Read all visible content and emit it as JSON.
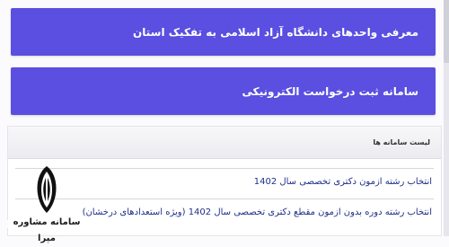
{
  "buttons": {
    "units_label": "معرفی واحدهای دانشگاه آزاد اسلامی به تفکیک استان",
    "online_request_label": "سامانه ثبت درخواست الکترونیکی"
  },
  "list": {
    "header": "لیست سامانه ها",
    "items": [
      "انتخاب رشته آزمون دکتری تخصصی سال 1402",
      "انتخاب رشته دوره بدون آزمون مقطع دکتری تخصصی سال 1402 (ویژه استعدادهای درخشان)"
    ]
  },
  "watermark": {
    "text": "سامانه مشاوره مپرا"
  },
  "colors": {
    "button_bg": "#5a4fe0",
    "link": "#1f2f88"
  }
}
